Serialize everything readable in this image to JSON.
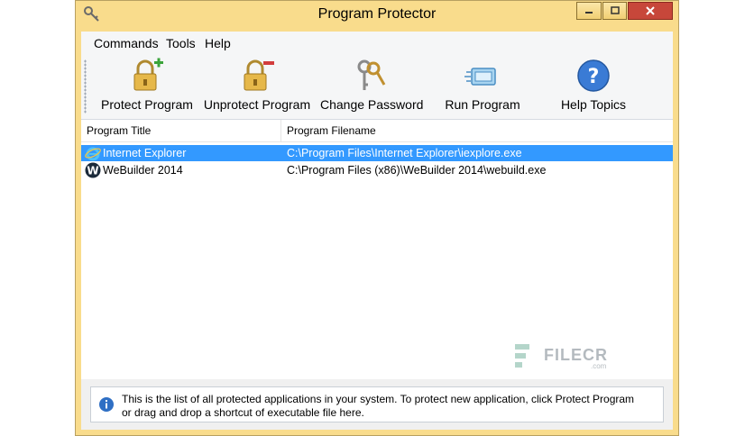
{
  "window": {
    "title": "Program Protector"
  },
  "menu": [
    "Commands",
    "Tools",
    "Help"
  ],
  "toolbar": [
    {
      "label": "Protect Program",
      "icon": "lock-plus-icon"
    },
    {
      "label": "Unprotect Program",
      "icon": "lock-minus-icon"
    },
    {
      "label": "Change Password",
      "icon": "keys-icon"
    },
    {
      "label": "Run Program",
      "icon": "run-window-icon"
    },
    {
      "label": "Help Topics",
      "icon": "help-question-icon"
    }
  ],
  "list": {
    "columns": [
      "Program Title",
      "Program Filename"
    ],
    "rows": [
      {
        "title": "Internet Explorer",
        "filename": "C:\\Program Files\\Internet Explorer\\iexplore.exe",
        "icon": "internet-explorer-icon",
        "selected": true
      },
      {
        "title": "WeBuilder 2014",
        "filename": "C:\\Program Files (x86)\\WeBuilder 2014\\webuild.exe",
        "icon": "webuilder-icon",
        "selected": false
      }
    ]
  },
  "status": {
    "icon": "info-icon",
    "line1": "This is the list of all protected applications in your system. To protect new application, click Protect Program",
    "line2": "or drag and drop a shortcut of executable file here."
  },
  "watermark": {
    "text": "FILECR",
    "sub": ".com"
  },
  "colors": {
    "frame": "#f9dc8c",
    "selection": "#3399ff",
    "close": "#c7473a"
  }
}
